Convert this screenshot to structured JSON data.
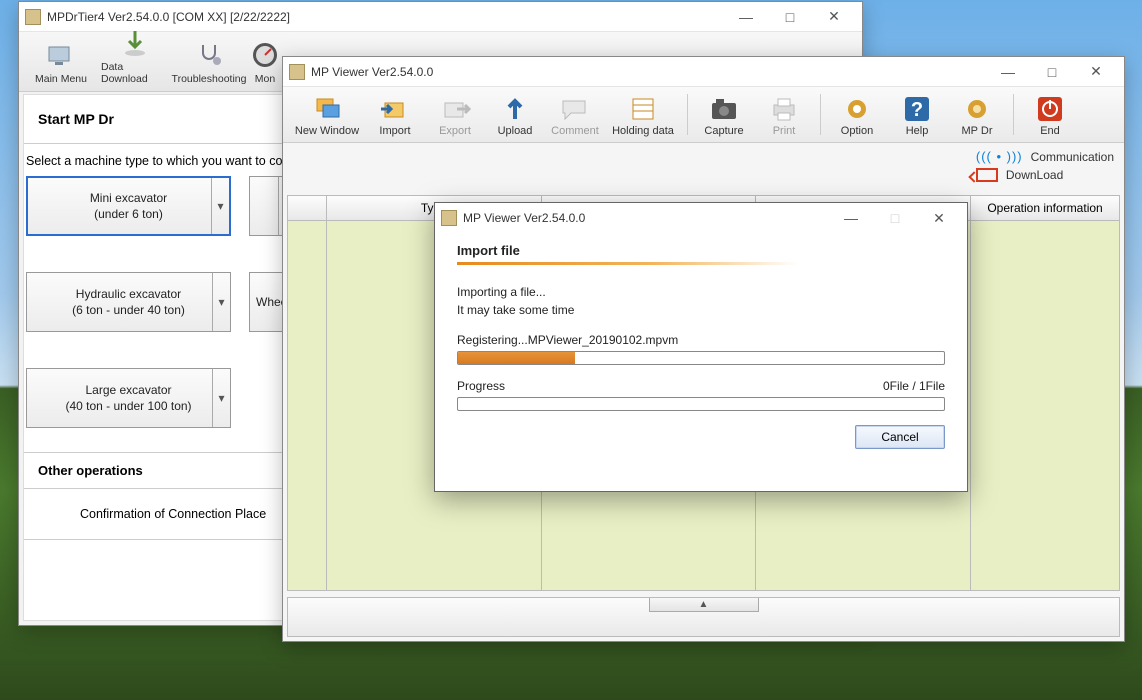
{
  "winA": {
    "title": "MPDrTier4 Ver2.54.0.0 [COM XX] [2/22/2222]",
    "toolbar": [
      "Main Menu",
      "Data Download",
      "Troubleshooting",
      "Mon"
    ],
    "start_header": "Start MP Dr",
    "select_line": "Select a machine type to which you want to connec",
    "machines": [
      {
        "l1": "Mini excavator",
        "l2": "(under 6 ton)"
      },
      {
        "l1": "",
        "l2": ""
      },
      {
        "l1": "Hydraulic excavator",
        "l2": "(6 ton - under 40 ton)"
      },
      {
        "l1": "Whee",
        "l2": ""
      },
      {
        "l1": "Large excavator",
        "l2": "(40 ton - under 100 ton)"
      }
    ],
    "other_header": "Other operations",
    "confirm": "Confirmation of Connection Place"
  },
  "winB": {
    "title": "MP Viewer Ver2.54.0.0",
    "toolbar": [
      {
        "k": "new",
        "label": "New Window"
      },
      {
        "k": "import",
        "label": "Import"
      },
      {
        "k": "export",
        "label": "Export"
      },
      {
        "k": "upload",
        "label": "Upload"
      },
      {
        "k": "comment",
        "label": "Comment"
      },
      {
        "k": "holding",
        "label": "Holding data"
      },
      {
        "k": "capture",
        "label": "Capture"
      },
      {
        "k": "print",
        "label": "Print"
      },
      {
        "k": "option",
        "label": "Option"
      },
      {
        "k": "help",
        "label": "Help"
      },
      {
        "k": "mpdr",
        "label": "MP Dr"
      },
      {
        "k": "end",
        "label": "End"
      }
    ],
    "status": {
      "comm": "Communication",
      "dl": "DownLoad"
    },
    "columns": [
      "",
      "Type",
      "",
      "",
      "Operation information"
    ]
  },
  "dlgC": {
    "title": "MP Viewer Ver2.54.0.0",
    "header": "Import file",
    "line1": "Importing a file...",
    "line2": "It may take some time",
    "reg": "Registering...MPViewer_20190102.mpvm",
    "progress_label": "Progress",
    "progress_count": "0File / 1File",
    "cancel": "Cancel"
  }
}
